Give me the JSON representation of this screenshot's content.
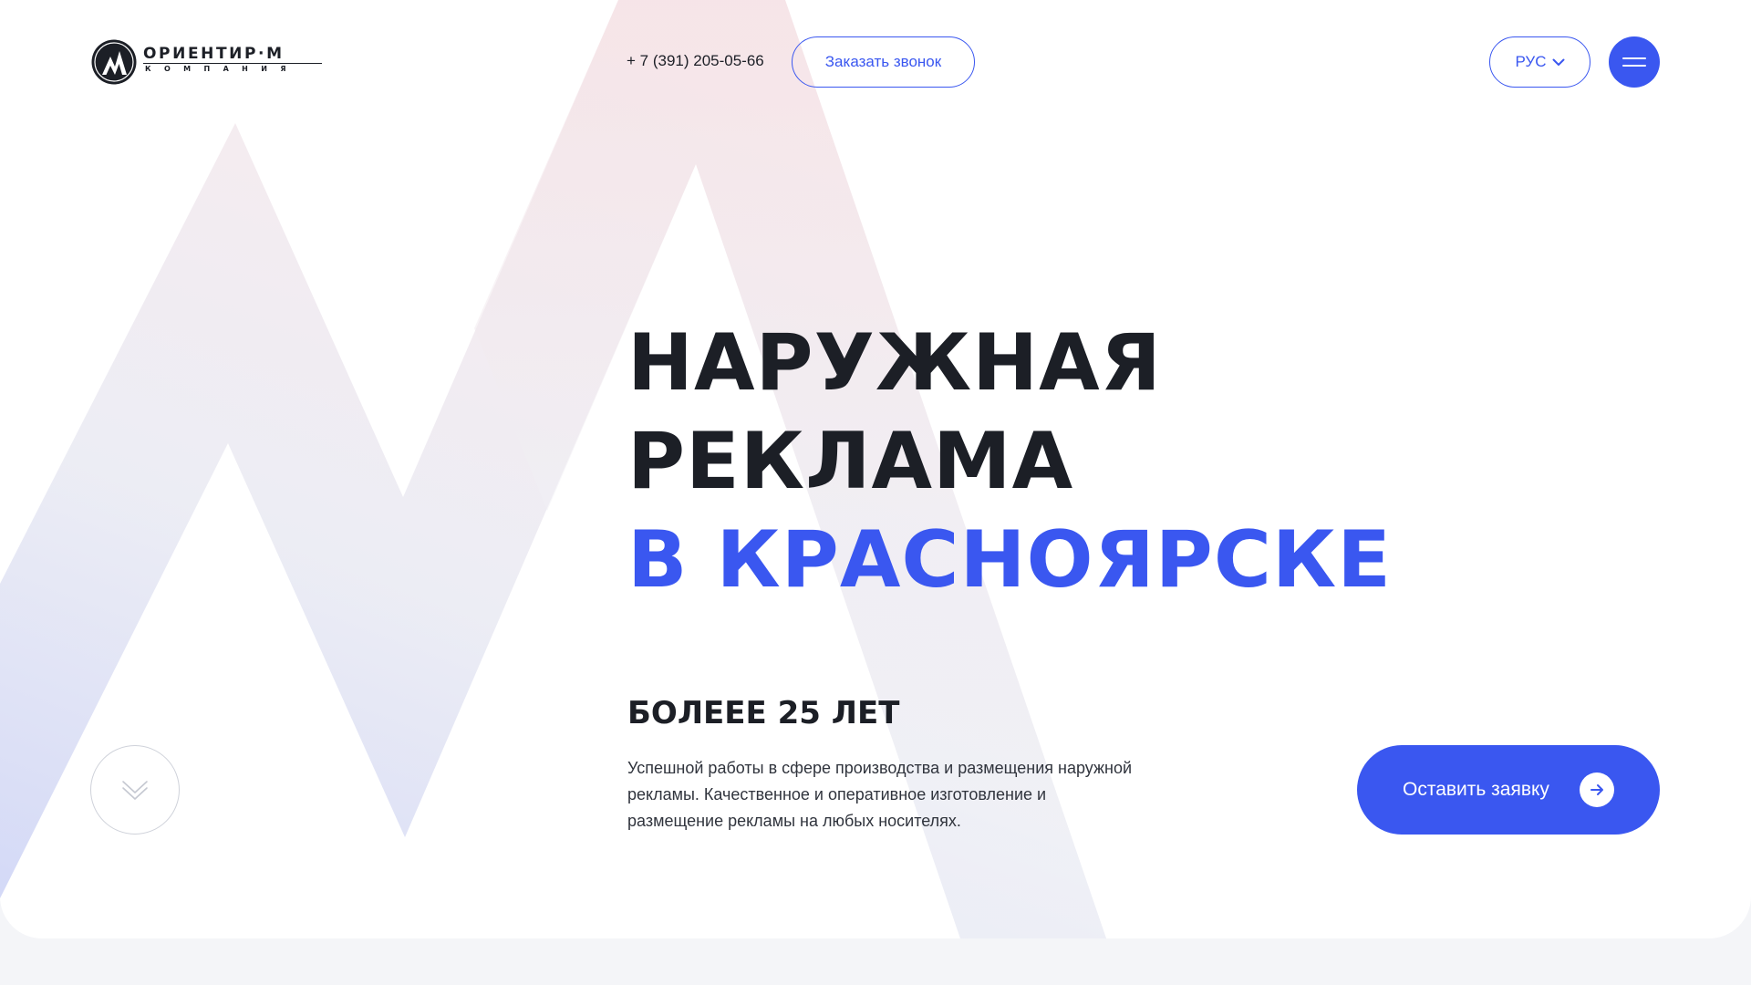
{
  "header": {
    "logo_title": "ОРИЕНТИР·М",
    "logo_subtitle": "КОМПАНИЯ",
    "phone": "+ 7 (391) 205-05-66",
    "call_button_label": "Заказать звонок",
    "language_label": "РУС"
  },
  "hero": {
    "title_line1": "НАРУЖНАЯ",
    "title_line2": "РЕКЛАМА",
    "title_line3": "В КРАСНОЯРСКЕ",
    "subtitle": "БОЛЕЕЕ 25 ЛЕТ",
    "description": "Успешной работы в сфере производства и размещения наружной рекламы.  Качественное и оперативное изготовление и размещение рекламы на любых носителях.",
    "cta_label": "Оставить заявку"
  },
  "icons": {
    "menu": "hamburger-menu-icon",
    "language": "chevron-down-icon",
    "scroll": "double-chevron-down-icon",
    "cta": "arrow-right-icon"
  },
  "colors": {
    "accent": "#3a57f0",
    "text_dark": "#1c1f26",
    "page_background": "#f4f5f8"
  }
}
